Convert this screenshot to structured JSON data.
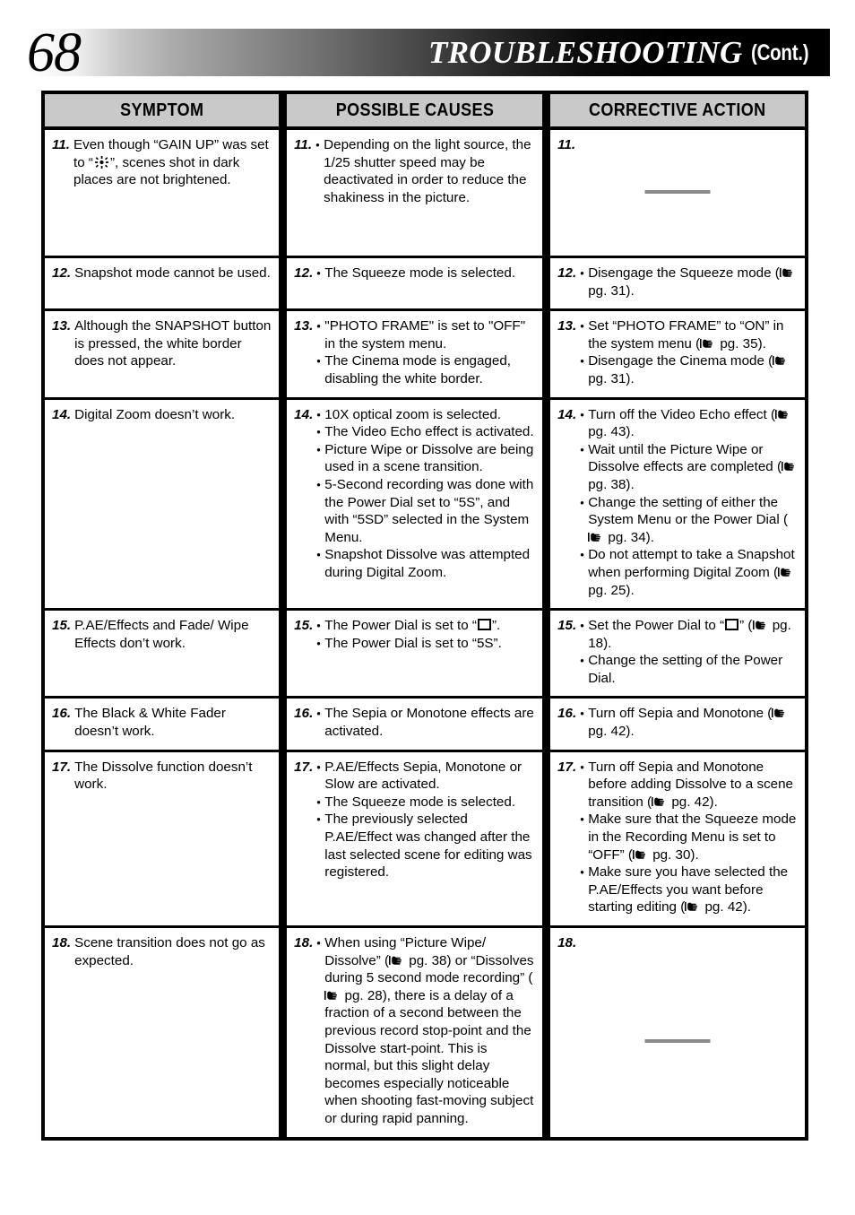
{
  "header": {
    "page_number": "68",
    "title": "TROUBLESHOOTING",
    "continued": "(Cont.)"
  },
  "table": {
    "columns": [
      {
        "label": "SYMPTOM"
      },
      {
        "label": "POSSIBLE CAUSES"
      },
      {
        "label": "CORRECTIVE ACTION"
      }
    ],
    "rows": [
      {
        "num": "11.",
        "symptom": {
          "pre": "Even though “GAIN UP” was set to “",
          "icon": "gain-up-icon",
          "post": "”, scenes shot in dark places are not brightened."
        },
        "causes": [
          "Depending on the light source, the 1/25 shutter speed may be deactivated in order to reduce the shakiness in the picture."
        ],
        "actions": [],
        "action_dash": true
      },
      {
        "num": "12.",
        "symptom_text": "Snapshot mode cannot be used.",
        "causes": [
          "The Squeeze mode is selected."
        ],
        "actions_rich": [
          {
            "pre": "Disengage the Squeeze mode (",
            "hand": true,
            "page": " pg. 31).",
            "post": ""
          }
        ],
        "action_dash": false
      },
      {
        "num": "13.",
        "symptom_text": "Although the SNAPSHOT button is pressed, the white border does not appear.",
        "causes": [
          "\"PHOTO FRAME\" is set to \"OFF\" in the system menu.",
          "The Cinema mode is engaged, disabling the white border."
        ],
        "actions_rich": [
          {
            "pre": "Set “PHOTO FRAME” to “ON” in the system menu (",
            "hand": true,
            "page": " pg. 35)."
          },
          {
            "pre": "Disengage the Cinema mode (",
            "hand": true,
            "page": " pg. 31)."
          }
        ],
        "action_dash": false
      },
      {
        "num": "14.",
        "symptom_text": "Digital Zoom doesn’t work.",
        "causes": [
          "10X optical zoom is selected.",
          "The Video Echo effect is activated.",
          "Picture Wipe or Dissolve are being used in a scene transition.",
          "5-Second recording was done with the Power Dial set to “5S”, and with “5SD” selected in the System Menu.",
          "Snapshot Dissolve was attempted during Digital Zoom."
        ],
        "actions_rich": [
          {
            "pre": "Turn off the Video Echo effect (",
            "hand": true,
            "page": " pg. 43)."
          },
          {
            "pre": "Wait until the Picture Wipe or Dissolve effects are completed (",
            "hand": true,
            "page": " pg. 38)."
          },
          {
            "pre": "Change the setting of either the System Menu or the Power Dial (",
            "hand": true,
            "page": " pg. 34)."
          },
          {
            "pre": "Do not attempt to take a Snapshot when performing Digital Zoom (",
            "hand": true,
            "page": " pg. 25)."
          }
        ],
        "action_dash": false
      },
      {
        "num": "15.",
        "symptom_text": "P.AE/Effects and Fade/ Wipe Effects don’t work.",
        "causes_rich": [
          {
            "pre": "The Power Dial is set to “",
            "dial": true,
            "post": "”."
          },
          {
            "pre": "The Power Dial is set to “5S”.",
            "dial": false,
            "post": ""
          }
        ],
        "actions_rich": [
          {
            "pre": "Set the Power Dial to “",
            "dial": true,
            "mid": "” (",
            "hand": true,
            "page": " pg. 18)."
          },
          {
            "pre": "Change the setting of the Power Dial."
          }
        ],
        "action_dash": false
      },
      {
        "num": "16.",
        "symptom_text": "The Black & White Fader doesn’t work.",
        "causes": [
          "The Sepia or Monotone effects are activated."
        ],
        "actions_rich": [
          {
            "pre": "Turn off Sepia and Monotone (",
            "hand": true,
            "page": " pg. 42)."
          }
        ],
        "action_dash": false
      },
      {
        "num": "17.",
        "symptom_text": "The Dissolve function doesn’t work.",
        "causes": [
          "P.AE/Effects Sepia, Monotone or Slow are activated.",
          "The Squeeze mode is selected.",
          "The previously selected P.AE/Effect was changed after the last selected scene for editing was registered."
        ],
        "actions_rich": [
          {
            "pre": "Turn off Sepia and Monotone before adding Dissolve to a scene transition (",
            "hand": true,
            "page": " pg. 42)."
          },
          {
            "pre": "Make sure that the Squeeze mode in the Recording Menu is set to “OFF” (",
            "hand": true,
            "page": " pg. 30)."
          },
          {
            "pre": "Make sure you have selected the P.AE/Effects you want before starting editing (",
            "hand": true,
            "page": " pg. 42)."
          }
        ],
        "action_dash": false
      },
      {
        "num": "18.",
        "symptom_text": "Scene transition does not go as expected.",
        "causes_multihand": [
          {
            "p1": "When using “Picture Wipe/ Dissolve” (",
            "h1": true,
            "p2": " pg. 38) or “Dissolves during 5 second mode recording” (",
            "h2": true,
            "p3": " pg. 28), there is a delay of a fraction of a second between the previous record stop-point and the Dissolve start-point. This is normal, but this slight delay becomes especially noticeable when shooting fast-moving subject or during rapid panning."
          }
        ],
        "actions": [],
        "action_dash": true
      }
    ]
  },
  "icons": {
    "gain_up": "gain-up-icon",
    "pointing_hand": "pointing-hand-icon",
    "power_dial": "power-dial-rect-icon"
  },
  "colors": {
    "header_gradient_start": "#ffffff",
    "header_gradient_end": "#000000",
    "table_border": "#000000",
    "table_head_fill": "#c9c9c9",
    "dash_gray": "#8a8a8a",
    "text": "#000000"
  }
}
